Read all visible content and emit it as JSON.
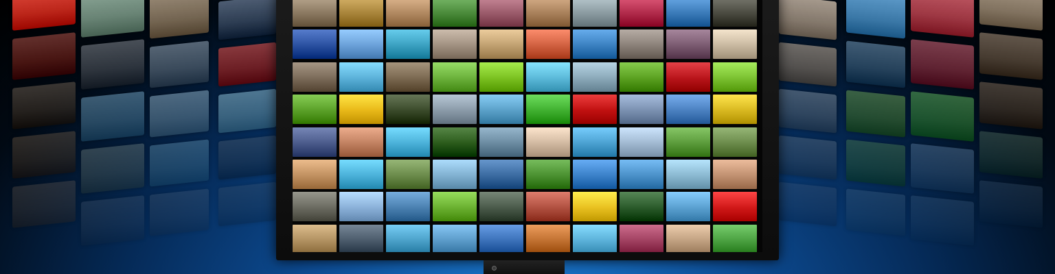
{
  "scene": {
    "left_wall_colors": [
      "#c82a1d",
      "#6e8a7a",
      "#7a6a55",
      "#2f3f55",
      "#5c1a14",
      "#3a4048",
      "#4a5a6a",
      "#8a2020",
      "#3b3025",
      "#3f6a86",
      "#5a7a90",
      "#5b8aa0",
      "#46331f",
      "#4a5a58",
      "#3e6e8a",
      "#27384a",
      "#5f4a36",
      "#35465a",
      "#38485a",
      "#2a3a4a"
    ],
    "right_wall_colors": [
      "#8a7a66",
      "#a63a46",
      "#3f7fb0",
      "#8b7e70",
      "#5a4a3a",
      "#7a2a3a",
      "#2f4f6a",
      "#6a6055",
      "#4a3a2a",
      "#2f7a2f",
      "#3a6a2a",
      "#4a5a6a",
      "#2d4a3a",
      "#3a5a7a",
      "#2a5a2a",
      "#3a4a5a",
      "#27415a",
      "#2a4a6a",
      "#30506a",
      "#2a3a50"
    ],
    "screen_colors": [
      "#8a7860",
      "#a8843a",
      "#b08860",
      "#4a8a3a",
      "#9a5a6a",
      "#a8805a",
      "#8a9aa0",
      "#b02a4a",
      "#3a7ab8",
      "#4a4a40",
      "#2a50a0",
      "#6aa0d8",
      "#3aa0c0",
      "#a09080",
      "#c0a070",
      "#d06040",
      "#3a80c0",
      "#8a8078",
      "#7a5a70",
      "#c8b8a0",
      "#7a6a58",
      "#5ab0d8",
      "#7a6850",
      "#6ab03a",
      "#7ac020",
      "#5ab8d8",
      "#8aa8b8",
      "#5aa020",
      "#b8141a",
      "#7ac030",
      "#5aa028",
      "#e8b818",
      "#3a4a2a",
      "#8a9aa8",
      "#5aa0c8",
      "#40b030",
      "#c01010",
      "#7a90b0",
      "#4a80c0",
      "#d8b820",
      "#4a5a8a",
      "#c08060",
      "#4ab0d8",
      "#2a5a1a",
      "#6a8aa0",
      "#d0b8a0",
      "#4aa0d0",
      "#a0b8d0",
      "#5a9a3a",
      "#6a8a4a",
      "#c09060",
      "#4ab0d8",
      "#6a8a4a",
      "#80b0d0",
      "#3a6aa0",
      "#4a9030",
      "#3a80c8",
      "#4a90c8",
      "#8ab8d0",
      "#c09070",
      "#6a6a60",
      "#8ab0d8",
      "#4a80b0",
      "#6ab030",
      "#4a5a4a",
      "#b05040",
      "#e8c020",
      "#2a5a2a",
      "#5aa0d0",
      "#d01818",
      "#b09060",
      "#4a5a6a",
      "#4aa0c8",
      "#5a9ac8",
      "#3a70b8",
      "#c07030",
      "#5ab0d8",
      "#a04060",
      "#c0a080",
      "#4aa040"
    ]
  }
}
